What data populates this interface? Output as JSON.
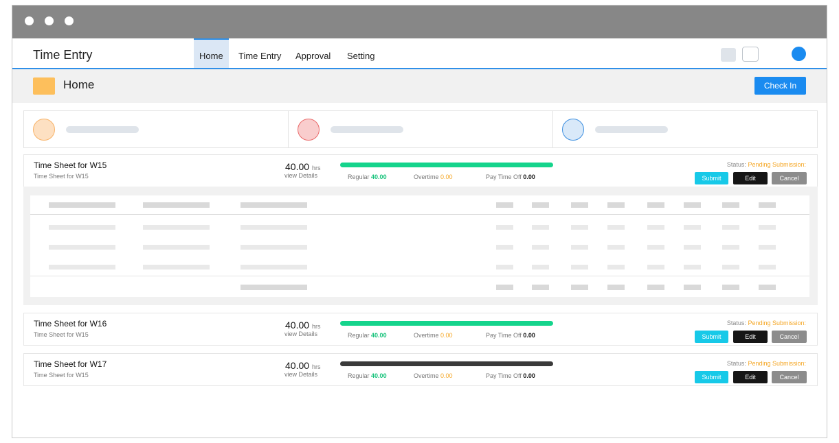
{
  "app": {
    "title": "Time Entry"
  },
  "nav": {
    "tabs": [
      {
        "label": "Home",
        "active": true
      },
      {
        "label": "Time Entry"
      },
      {
        "label": "Approval"
      },
      {
        "label": "Setting"
      }
    ]
  },
  "page": {
    "title": "Home",
    "check_in_label": "Check In"
  },
  "colors": {
    "accent": "#1a8bf0",
    "progress_green": "#15d48c",
    "progress_dark": "#3a3a3a",
    "pending": "#f5a623",
    "regular": "#15c27a"
  },
  "stat_cards": [
    {
      "circle_fill": "#fde0c2",
      "circle_stroke": "#f8b267"
    },
    {
      "circle_fill": "#f9cdcd",
      "circle_stroke": "#ea6b6b"
    },
    {
      "circle_fill": "#d9e9f9",
      "circle_stroke": "#3b8ee0"
    }
  ],
  "timesheets": [
    {
      "title": "Time Sheet for W15",
      "subtitle": "Time Sheet for W15",
      "hours": "40.00",
      "hours_unit": "hrs",
      "view_details": "view Details",
      "regular_label": "Regular",
      "regular": "40.00",
      "overtime_label": "Overtime",
      "overtime": "0.00",
      "pto_label": "Pay Time Off",
      "pto": "0.00",
      "status_label": "Status:",
      "status": "Pending Submission:",
      "submit": "Submit",
      "edit": "Edit",
      "cancel": "Cancel",
      "progress": 1.0,
      "bar_color": "#15d48c"
    },
    {
      "title": "Time Sheet for W16",
      "subtitle": "Time Sheet for W15",
      "hours": "40.00",
      "hours_unit": "hrs",
      "view_details": "view Details",
      "regular_label": "Regular",
      "regular": "40.00",
      "overtime_label": "Overtime",
      "overtime": "0.00",
      "pto_label": "Pay Time Off",
      "pto": "0.00",
      "status_label": "Status:",
      "status": "Pending Submission:",
      "submit": "Submit",
      "edit": "Edit",
      "cancel": "Cancel",
      "progress": 1.0,
      "bar_color": "#15d48c"
    },
    {
      "title": "Time Sheet for W17",
      "subtitle": "Time Sheet for W15",
      "hours": "40.00",
      "hours_unit": "hrs",
      "view_details": "view Details",
      "regular_label": "Regular",
      "regular": "40.00",
      "overtime_label": "Overtime",
      "overtime": "0.00",
      "pto_label": "Pay Time Off",
      "pto": "0.00",
      "status_label": "Status:",
      "status": "Pending Submission:",
      "submit": "Submit",
      "edit": "Edit",
      "cancel": "Cancel",
      "progress": 1.0,
      "bar_color": "#3a3a3a"
    }
  ]
}
